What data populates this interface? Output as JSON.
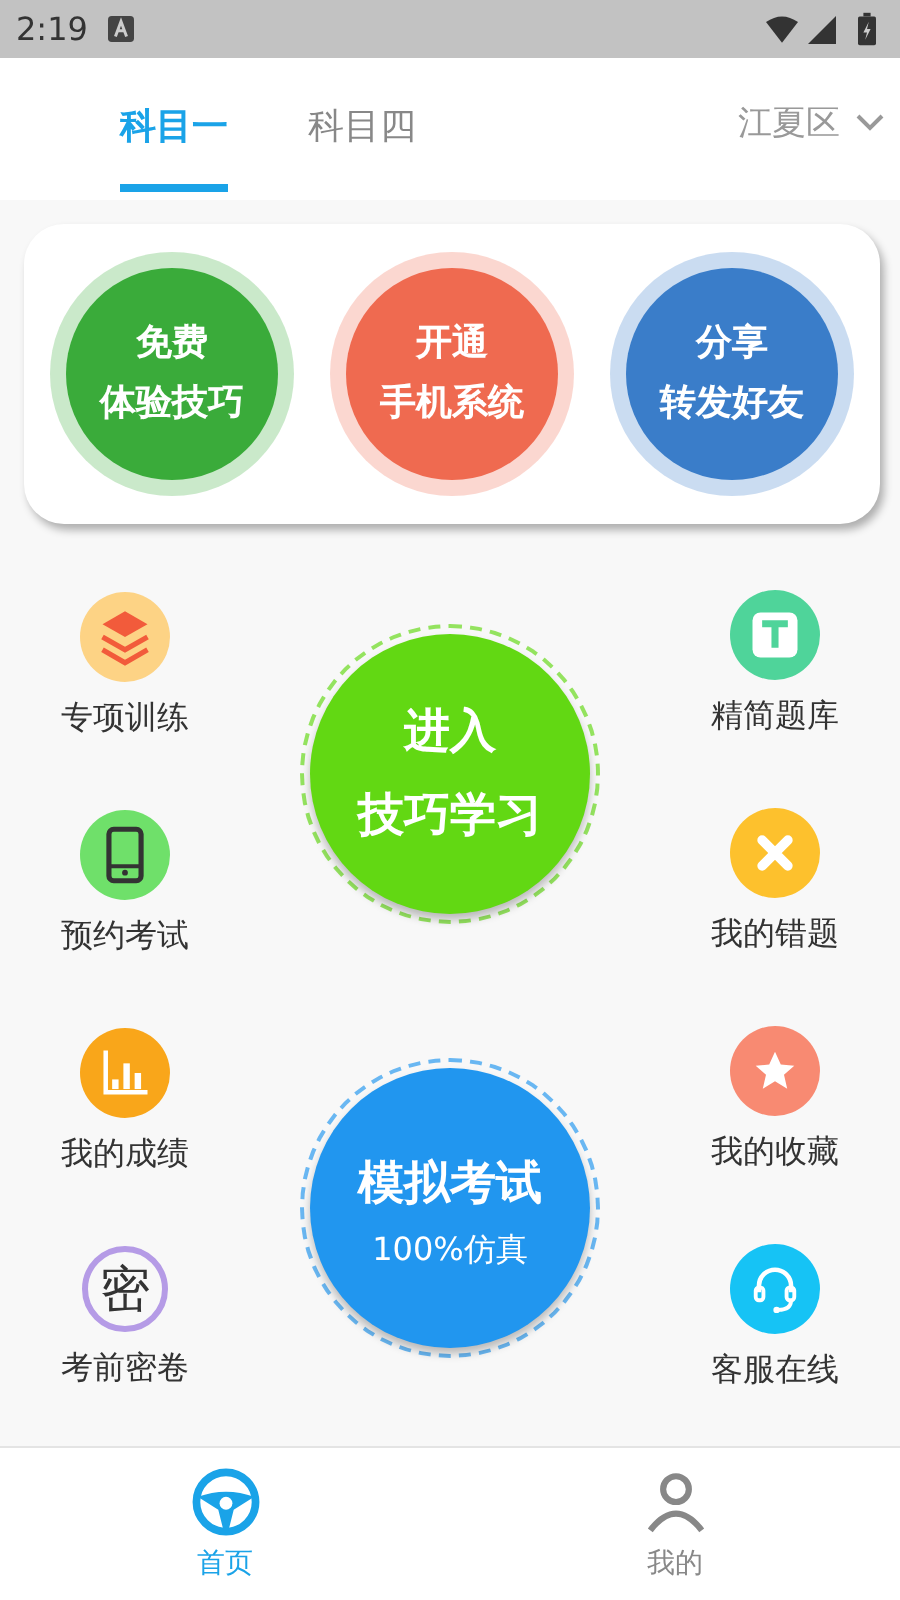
{
  "status_bar": {
    "time": "2:19"
  },
  "tabs": [
    {
      "label": "科目一",
      "selected": true
    },
    {
      "label": "科目四",
      "selected": false
    }
  ],
  "region": {
    "label": "江夏区"
  },
  "quick_actions": [
    {
      "lines": [
        "免费",
        "体验技巧"
      ],
      "color": "#3aab3a"
    },
    {
      "lines": [
        "开通",
        "手机系统"
      ],
      "color": "#ef6a50"
    },
    {
      "lines": [
        "分享",
        "转发好友"
      ],
      "color": "#3a7dc9"
    }
  ],
  "left_items": [
    {
      "kind": "layers",
      "label": "专项训练",
      "color": "#fdd385"
    },
    {
      "kind": "tablet",
      "label": "预约考试",
      "color": "#6fe06a"
    },
    {
      "kind": "chart",
      "label": "我的成绩",
      "color": "#f9a61a"
    },
    {
      "kind": "glyph",
      "glyph": "密",
      "label": "考前密卷",
      "color": "#b59be6"
    }
  ],
  "center_buttons": [
    {
      "title_lines": [
        "进入",
        "技巧学习"
      ],
      "color": "#62d813"
    },
    {
      "title_lines": [
        "模拟考试"
      ],
      "subtitle": "100%仿真",
      "color": "#2196ef"
    }
  ],
  "right_items": [
    {
      "kind": "t",
      "label": "精简题库",
      "color": "#4fd49a"
    },
    {
      "kind": "x",
      "label": "我的错题",
      "color": "#fdc12d"
    },
    {
      "kind": "star",
      "label": "我的收藏",
      "color": "#f88a72"
    },
    {
      "kind": "headset",
      "label": "客服在线",
      "color": "#16c3f5"
    }
  ],
  "nav": [
    {
      "kind": "wheel",
      "label": "首页",
      "selected": true
    },
    {
      "kind": "person",
      "label": "我的",
      "selected": false
    }
  ]
}
